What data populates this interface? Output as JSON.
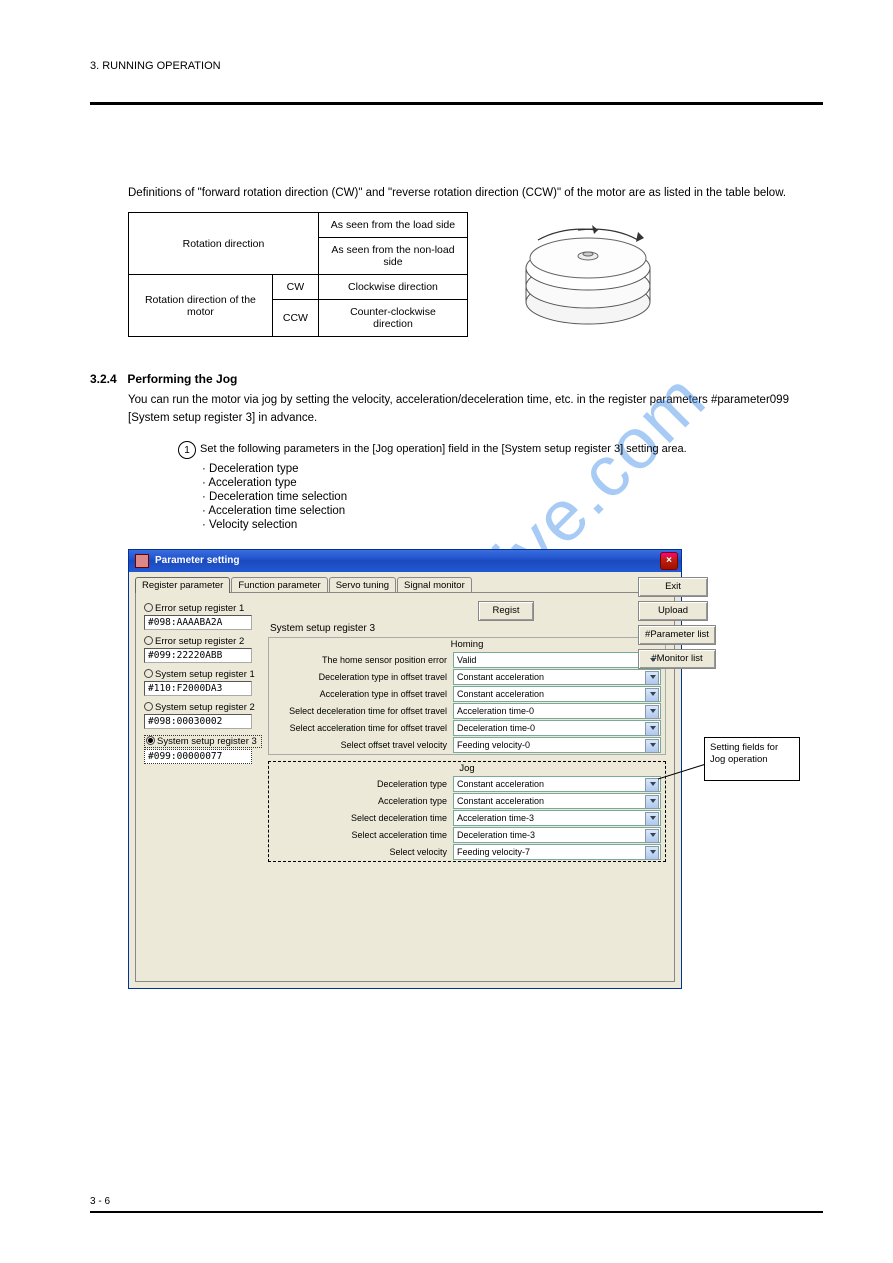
{
  "header": {
    "left": "3. RUNNING OPERATION",
    "right": ""
  },
  "footer": {
    "left": "3 - 6",
    "right": ""
  },
  "watermark": "manualsarchive.com",
  "intro": {
    "def": "Definitions of \"forward rotation direction (CW)\" and \"reverse rotation direction (CCW)\" of the motor are as listed in the table below."
  },
  "rot_table": {
    "h1": "Rotation direction",
    "h2a": "As seen from the load side",
    "h2b": "As seen from the non-load side",
    "r1a": "Rotation direction of the motor",
    "r1b_cw": "CW",
    "r1c_cw": "Clockwise direction",
    "r1d_cw": "Counter-clockwise direction",
    "r1b_ccw": "CCW",
    "r1c_ccw": "Counter-clockwise direction",
    "r1d_ccw": "Clockwise direction"
  },
  "section": {
    "num": "3.2.4",
    "title": "Performing the Jog"
  },
  "para1": "You can run the motor via jog by setting the velocity, acceleration/deceleration time, etc. in the register parameters #parameter099 [System setup register 3] in advance.",
  "step": {
    "n": "1",
    "text": "Set the following parameters in the [Jog operation] field in the [System setup register 3] setting area.",
    "items": [
      "Deceleration type",
      "Acceleration type",
      "Deceleration time selection",
      "Acceleration time selection",
      "Velocity selection"
    ]
  },
  "dialog": {
    "title": "Parameter setting",
    "tabs": [
      "Register parameter",
      "Function parameter",
      "Servo tuning",
      "Signal monitor"
    ],
    "buttons": {
      "regist": "Regist",
      "exit": "Exit",
      "upload": "Upload",
      "paramlist": "#Parameter list",
      "monlist": "#Monitor list"
    },
    "side": [
      {
        "label": "Error setup register 1",
        "val": "#098:AAAABA2A"
      },
      {
        "label": "Error setup register 2",
        "val": "#099:22220ABB"
      },
      {
        "label": "System setup register 1",
        "val": "#110:F2000DA3"
      },
      {
        "label": "System setup register 2",
        "val": "#098:00030002"
      },
      {
        "label": "System setup register 3",
        "val": "#099:00000077",
        "selected": true
      }
    ],
    "sys_title": "System setup register 3",
    "group1": {
      "title": "Homing",
      "rows": [
        {
          "label": "The home sensor position error",
          "val": "Valid"
        },
        {
          "label": "Deceleration type in offset travel",
          "val": "Constant acceleration"
        },
        {
          "label": "Acceleration type in offset travel",
          "val": "Constant acceleration"
        },
        {
          "label": "Select deceleration time for offset travel",
          "val": "Acceleration time-0"
        },
        {
          "label": "Select acceleration time for offset travel",
          "val": "Deceleration time-0"
        },
        {
          "label": "Select offset travel velocity",
          "val": "Feeding velocity-0"
        }
      ]
    },
    "group2": {
      "title": "Jog",
      "rows": [
        {
          "label": "Deceleration type",
          "val": "Constant acceleration"
        },
        {
          "label": "Acceleration type",
          "val": "Constant acceleration"
        },
        {
          "label": "Select deceleration time",
          "val": "Acceleration time-3"
        },
        {
          "label": "Select acceleration time",
          "val": "Deceleration time-3"
        },
        {
          "label": "Select velocity",
          "val": "Feeding velocity-7"
        }
      ]
    },
    "callout": "Setting fields for Jog operation"
  }
}
